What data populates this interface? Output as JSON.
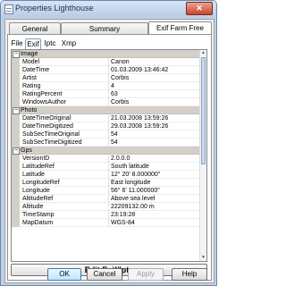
{
  "window": {
    "title": "Properties Lighthouse",
    "close_label": "✕"
  },
  "tabs": [
    "General",
    "Summary",
    "Exif Farm Free"
  ],
  "subtabs": [
    "File",
    "Exif",
    "Iptc",
    "Xmp"
  ],
  "sections": [
    {
      "label": "Image",
      "rows": [
        [
          "Model",
          "Canon"
        ],
        [
          "DateTime",
          "01.03.2009 13:46:42"
        ],
        [
          "Artist",
          "Corbis"
        ],
        [
          "Rating",
          "4"
        ],
        [
          "RatingPercent",
          "63"
        ],
        [
          "WindowsAuthor",
          "Corbis"
        ]
      ]
    },
    {
      "label": "Photo",
      "rows": [
        [
          "DateTimeOriginal",
          "21.03.2008 13:59:26"
        ],
        [
          "DateTimeDigitized",
          "29.03.2008 13:59:26"
        ],
        [
          "SubSecTimeOriginal",
          "54"
        ],
        [
          "SubSecTimeDigitized",
          "54"
        ]
      ]
    },
    {
      "label": "Gps",
      "rows": [
        [
          "VersionID",
          "2.0.0.0"
        ],
        [
          "LatitudeRef",
          "South latitude"
        ],
        [
          "Latitude",
          "12° 20' 8.000000\""
        ],
        [
          "LongitudeRef",
          "East longitude"
        ],
        [
          "Longitude",
          "56° 6' 11.000000\""
        ],
        [
          "AltitudeRef",
          "Above sea level"
        ],
        [
          "Altitude",
          "22209132.00 m"
        ],
        [
          "TimeStamp",
          "23:19:28"
        ],
        [
          "MapDatum",
          "WGS-84"
        ]
      ]
    }
  ],
  "buttons": {
    "edit": "Edit Exif/Iptc",
    "ok": "OK",
    "cancel": "Cancel",
    "apply": "Apply",
    "help": "Help"
  }
}
